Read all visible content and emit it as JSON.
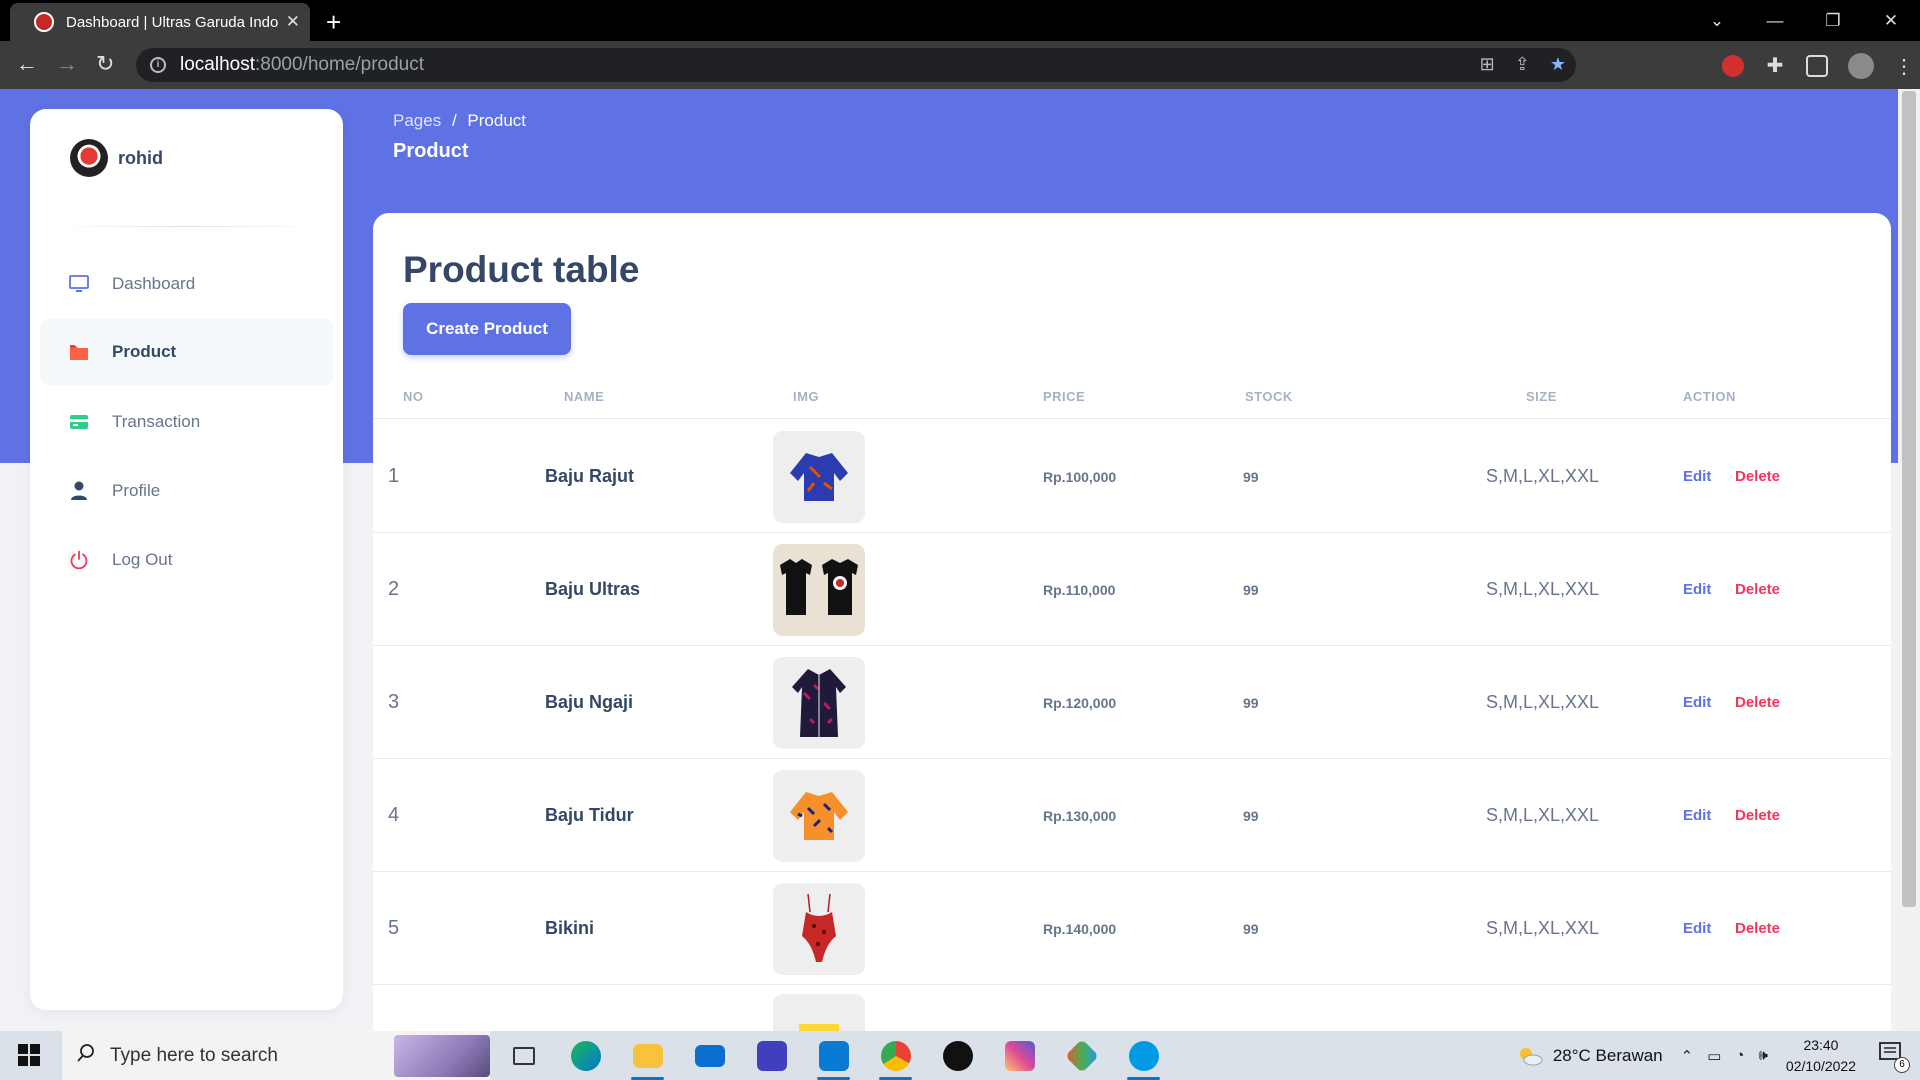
{
  "browser": {
    "tab_title": "Dashboard | Ultras Garuda Indon",
    "url_host": "localhost",
    "url_path": ":8000/home/product"
  },
  "sidebar": {
    "brand": "rohid",
    "items": [
      {
        "label": "Dashboard",
        "icon": "monitor-icon"
      },
      {
        "label": "Product",
        "icon": "folder-icon"
      },
      {
        "label": "Transaction",
        "icon": "credit-card-icon"
      },
      {
        "label": "Profile",
        "icon": "user-icon"
      },
      {
        "label": "Log Out",
        "icon": "power-icon"
      }
    ]
  },
  "header": {
    "breadcrumb_root": "Pages",
    "breadcrumb_sep": "/",
    "breadcrumb_current": "Product",
    "title": "Product"
  },
  "main": {
    "card_title": "Product table",
    "create_button": "Create Product",
    "columns": [
      "NO",
      "NAME",
      "IMG",
      "PRICE",
      "STOCK",
      "SIZE",
      "ACTION"
    ],
    "edit_label": "Edit",
    "delete_label": "Delete",
    "rows": [
      {
        "no": "1",
        "name": "Baju Rajut",
        "price": "Rp.100,000",
        "stock": "99",
        "size": "S,M,L,XL,XXL"
      },
      {
        "no": "2",
        "name": "Baju Ultras",
        "price": "Rp.110,000",
        "stock": "99",
        "size": "S,M,L,XL,XXL"
      },
      {
        "no": "3",
        "name": "Baju Ngaji",
        "price": "Rp.120,000",
        "stock": "99",
        "size": "S,M,L,XL,XXL"
      },
      {
        "no": "4",
        "name": "Baju Tidur",
        "price": "Rp.130,000",
        "stock": "99",
        "size": "S,M,L,XL,XXL"
      },
      {
        "no": "5",
        "name": "Bikini",
        "price": "Rp.140,000",
        "stock": "99",
        "size": "S,M,L,XL,XXL"
      }
    ]
  },
  "taskbar": {
    "search_placeholder": "Type here to search",
    "weather": "28°C  Berawan",
    "time": "23:40",
    "date": "02/10/2022",
    "notification_count": "6"
  },
  "colors": {
    "primary": "#5e72e4",
    "danger": "#f5365c",
    "heading": "#344767",
    "muted": "#67748e"
  }
}
